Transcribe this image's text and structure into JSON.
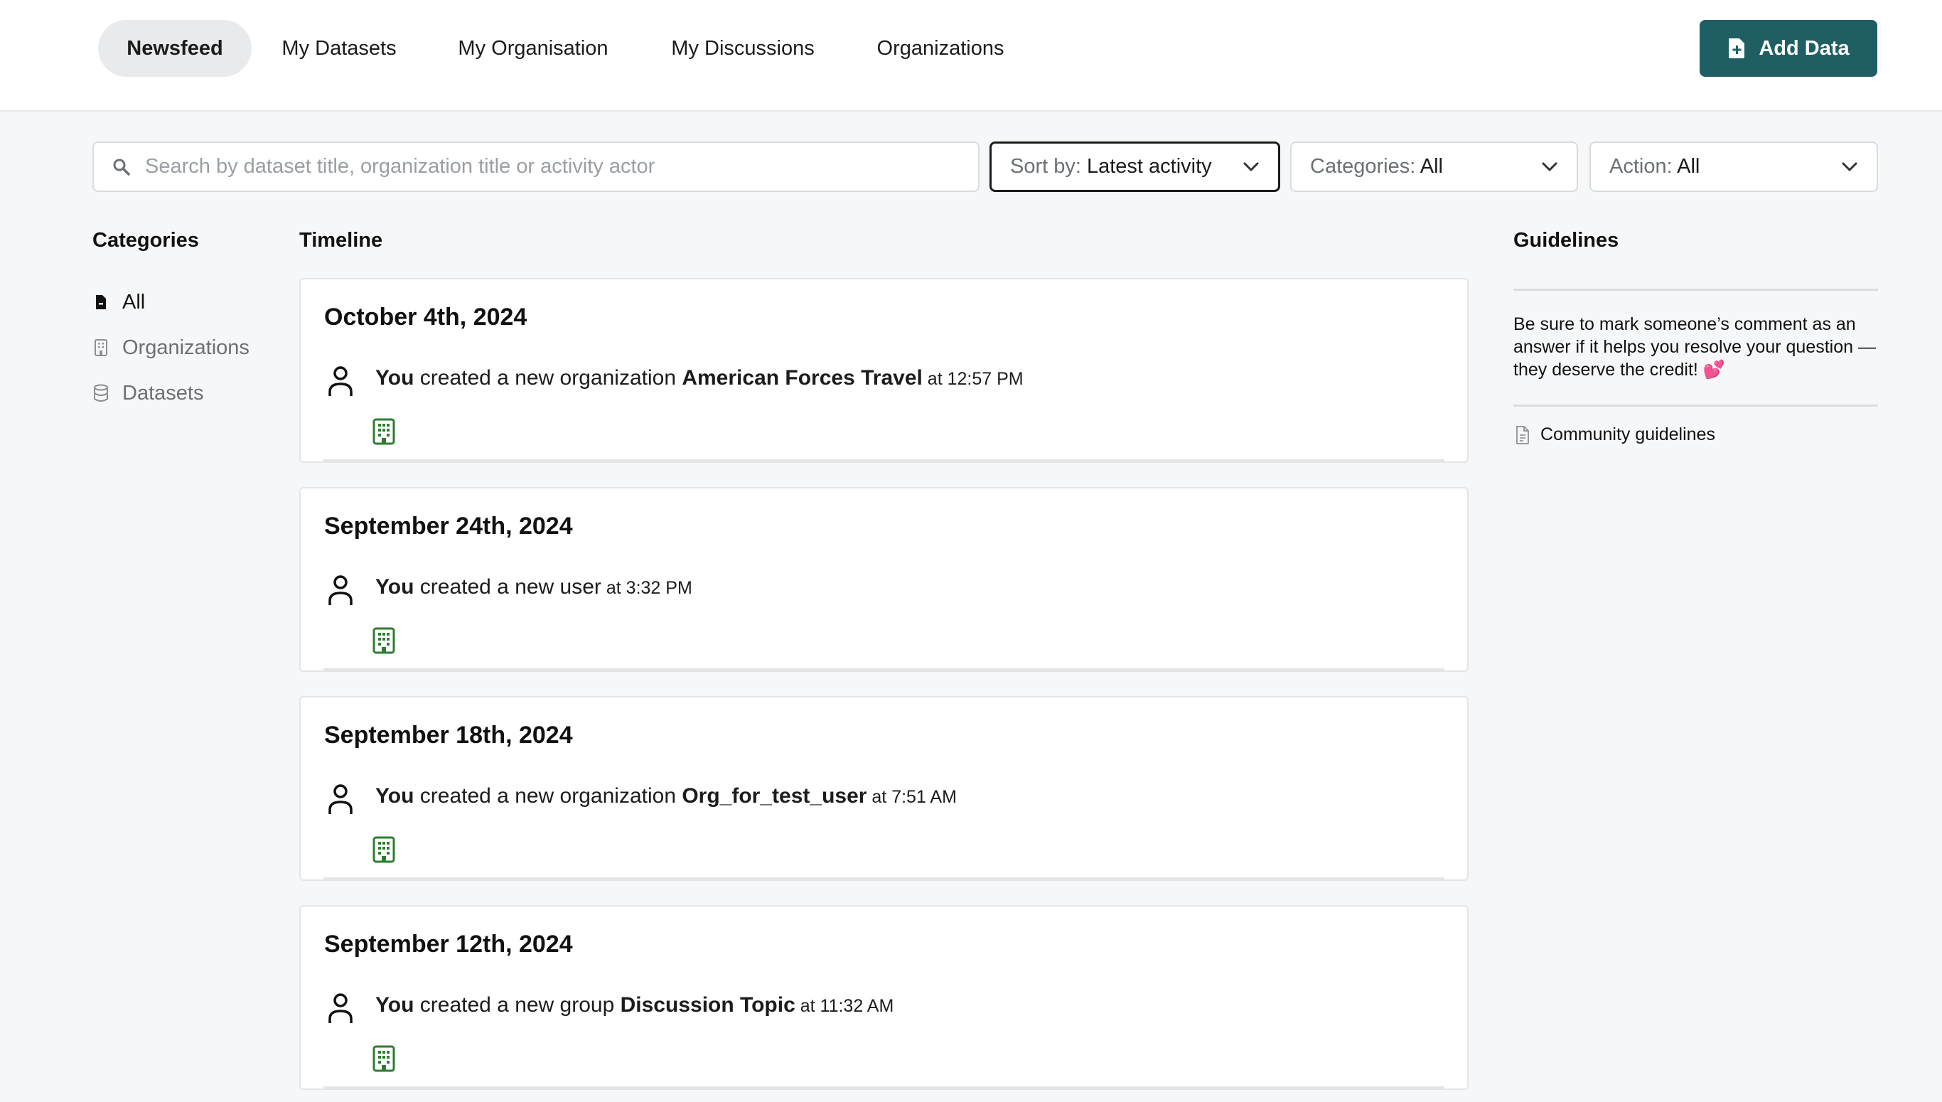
{
  "nav": {
    "tabs": [
      {
        "label": "Newsfeed",
        "active": true
      },
      {
        "label": "My Datasets"
      },
      {
        "label": "My Organisation"
      },
      {
        "label": "My Discussions"
      },
      {
        "label": "Organizations"
      }
    ],
    "add_button": "Add Data",
    "accent_color": "#1f5f63"
  },
  "filters": {
    "search_placeholder": "Search by dataset title, organization title or activity actor",
    "sort": {
      "label": "Sort by:",
      "value": " Latest activity"
    },
    "categories": {
      "label": "Categories:",
      "value": " All"
    },
    "action": {
      "label": "Action:",
      "value": " All"
    }
  },
  "categories": {
    "heading": "Categories",
    "items": [
      {
        "label": "All",
        "icon": "file-icon"
      },
      {
        "label": "Organizations",
        "icon": "building-icon"
      },
      {
        "label": "Datasets",
        "icon": "database-icon"
      }
    ]
  },
  "timeline": {
    "heading": "Timeline",
    "entries": [
      {
        "date": "October 4th, 2024",
        "actor": "You",
        "action": " created a new organization ",
        "object": "American Forces Travel",
        "time": " at 12:57 PM"
      },
      {
        "date": "September 24th, 2024",
        "actor": "You",
        "action": " created a new user",
        "object": "",
        "time": " at 3:32 PM"
      },
      {
        "date": "September 18th, 2024",
        "actor": "You",
        "action": " created a new organization ",
        "object": "Org_for_test_user",
        "time": " at 7:51 AM"
      },
      {
        "date": "September 12th, 2024",
        "actor": "You",
        "action": " created a new group ",
        "object": "Discussion Topic",
        "time": " at 11:32 AM"
      }
    ]
  },
  "guidelines": {
    "heading": "Guidelines",
    "text": "Be sure to mark someone’s comment as an answer if it helps you resolve your question — they deserve the credit! 💕",
    "link": "Community guidelines"
  }
}
